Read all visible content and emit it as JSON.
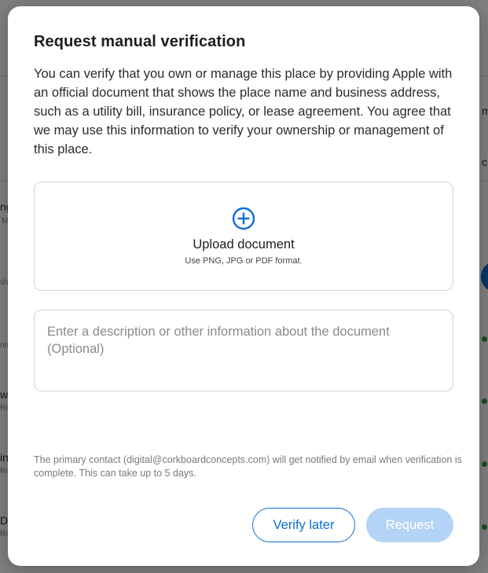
{
  "background": {
    "fragments": [
      "m",
      "c",
      "ng",
      "M",
      "sh",
      "nn",
      "w",
      "Ro",
      "in",
      "Ro",
      "D",
      "Ro"
    ]
  },
  "modal": {
    "title": "Request manual verification",
    "body": "You can verify that you own or manage this place by providing Apple with an official document that shows the place name and business address, such as a utility bill, insurance policy, or lease agreement. You agree that we may use this information to verify your ownership or management of this place.",
    "upload": {
      "icon": "plus-circle-icon",
      "title": "Upload document",
      "hint": "Use PNG, JPG or PDF format."
    },
    "description_field": {
      "value": "",
      "placeholder": "Enter a description or other information about the document (Optional)"
    },
    "notice": "The primary contact (digital@corkboardconcepts.com) will get notified by email when verification is complete. This can take up to 5 days.",
    "buttons": {
      "verify_later": "Verify later",
      "request": "Request"
    }
  },
  "colors": {
    "accent": "#0a6fd0",
    "request_disabled": "#b3d4f6",
    "status_dot": "#2e9d3f"
  }
}
